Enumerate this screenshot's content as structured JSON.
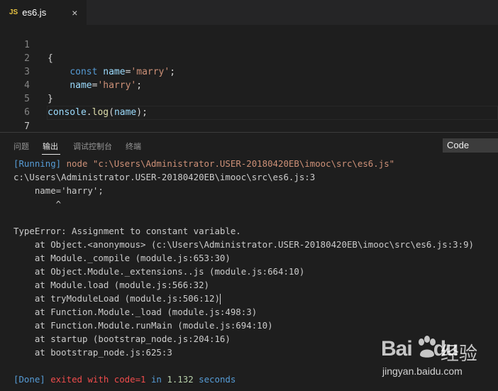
{
  "tab": {
    "icon_label": "JS",
    "title": "es6.js",
    "close": "×"
  },
  "editor": {
    "line_numbers": [
      "1",
      "2",
      "3",
      "4",
      "5",
      "6",
      "7"
    ],
    "lines": [
      "{",
      "    const name='marry';",
      "    name='harry';",
      "}",
      "console.log(name);",
      "",
      ""
    ]
  },
  "panel": {
    "tabs": [
      "问题",
      "输出",
      "调试控制台",
      "终端"
    ],
    "active_tab": "输出",
    "select_value": "Code"
  },
  "output": {
    "running_tag": "[Running]",
    "running_cmd": " node \"c:\\Users\\Administrator.USER-20180420EB\\imooc\\src\\es6.js\"",
    "lines": [
      "c:\\Users\\Administrator.USER-20180420EB\\imooc\\src\\es6.js:3",
      "    name='harry';",
      "        ^",
      "",
      "TypeError: Assignment to constant variable.",
      "    at Object.<anonymous> (c:\\Users\\Administrator.USER-20180420EB\\imooc\\src\\es6.js:3:9)",
      "    at Module._compile (module.js:653:30)",
      "    at Object.Module._extensions..js (module.js:664:10)",
      "    at Module.load (module.js:566:32)",
      "    at tryModuleLoad (module.js:506:12)",
      "    at Function.Module._load (module.js:498:3)",
      "    at Function.Module.runMain (module.js:694:10)",
      "    at startup (bootstrap_node.js:204:16)",
      "    at bootstrap_node.js:625:3",
      ""
    ],
    "done_tag": "[Done]",
    "done_exited": " exited with ",
    "done_code": "code=1",
    "done_in": " in ",
    "done_time": "1.132",
    "done_seconds": " seconds"
  },
  "watermark": {
    "logo": "Bai",
    "logo2": "du",
    "cn": "经验",
    "url": "jingyan.baidu.com"
  },
  "colors": {
    "background": "#1e1e1e",
    "keyword": "#569cd6",
    "string": "#ce9178",
    "error": "#f14c4c"
  }
}
